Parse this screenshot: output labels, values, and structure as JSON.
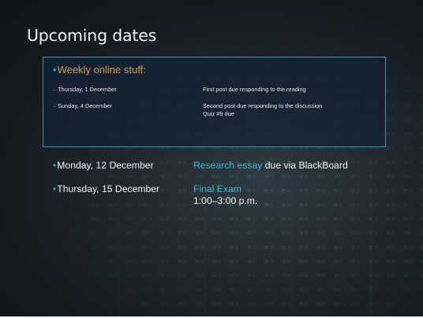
{
  "slide": {
    "title": "Upcoming dates",
    "weekly": {
      "heading": "Weekly online stuff:",
      "items": [
        {
          "day": "Thursday, 1 December",
          "tasks": [
            "First post due responding to the reading"
          ]
        },
        {
          "day": "Sunday, 4 December",
          "tasks": [
            "Second post due responding to the discussion",
            "Quiz #9 due"
          ]
        }
      ]
    },
    "deadlines": [
      {
        "date": "Monday, 12 December",
        "highlight": "Research essay",
        "rest": " due via BlackBoard"
      },
      {
        "date": "Thursday, 15 December",
        "highlight": "Final Exam",
        "time": "1:00–3:00 p.m."
      }
    ],
    "colors": {
      "accent": "#45b6d2",
      "heading_orange": "#d49a4f",
      "box_border": "#2f97b4",
      "background": "#1f272d"
    }
  }
}
